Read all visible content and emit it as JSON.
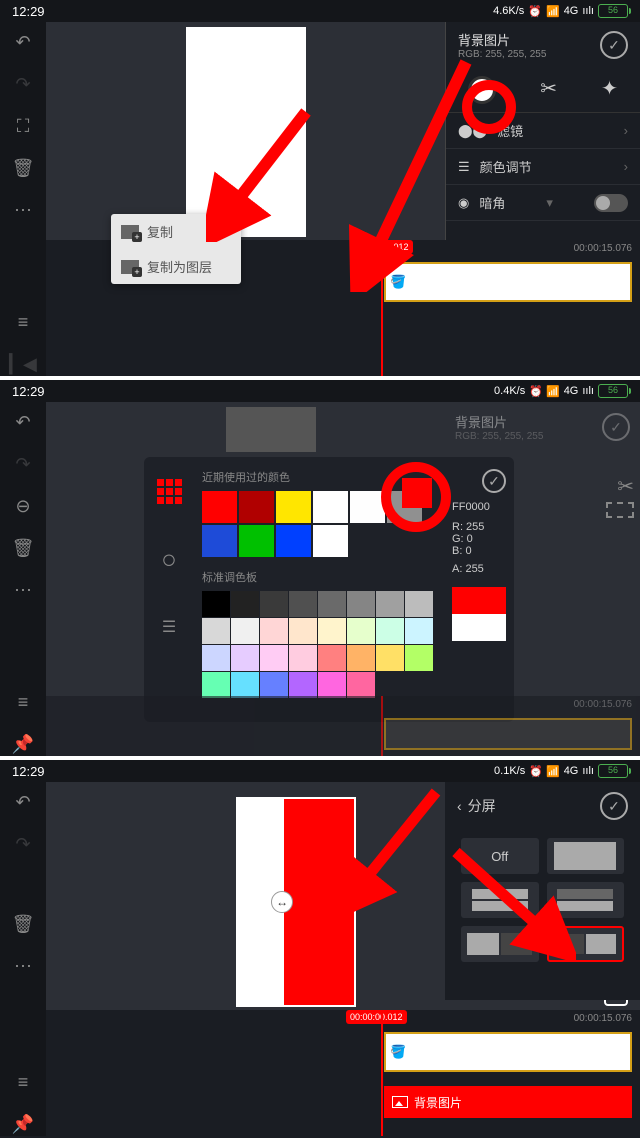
{
  "status": {
    "time": "12:29",
    "speed1": "4.6K/s",
    "speed2": "0.4K/s",
    "speed3": "0.1K/s",
    "net": "4G",
    "battery": "56"
  },
  "panel": {
    "title": "背景图片",
    "rgb": "RGB: 255, 255, 255",
    "filter": "滤镜",
    "coloradj": "颜色调节",
    "vignette": "暗角"
  },
  "popup": {
    "copy": "复制",
    "copyAsLayer": "复制为图层"
  },
  "timeline": {
    "start": "00:00:00.012",
    "end": "00:00:15.076"
  },
  "colorpicker": {
    "recent": "近期使用过的颜色",
    "standard": "标准调色板",
    "hex": "FF0000",
    "r": "R: 255",
    "g": "G: 0",
    "b": "B: 0",
    "a": "A: 255",
    "recentColors": [
      "#ff0000",
      "#b00000",
      "#ffe600",
      "#ffffff",
      "#fefefe",
      "#909090",
      "#1e4bd8",
      "#00c000",
      "#0040ff",
      "#ffffff"
    ],
    "stdColors": [
      "#000000",
      "#222222",
      "#3a3a3a",
      "#505050",
      "#6a6a6a",
      "#858585",
      "#a0a0a0",
      "#bcbcbc",
      "#d8d8d8",
      "#f0f0f0",
      "#ffd6d6",
      "#ffe6cc",
      "#fff4cc",
      "#e6ffcc",
      "#ccffe6",
      "#ccf4ff",
      "#ccd6ff",
      "#e6ccff",
      "#ffccf4",
      "#ffcce0",
      "#ff8080",
      "#ffb366",
      "#ffe066",
      "#b3ff66",
      "#66ffb3",
      "#66e0ff",
      "#6680ff",
      "#b366ff",
      "#ff66e0",
      "#ff66a0"
    ]
  },
  "split": {
    "title": "分屏",
    "off": "Off"
  },
  "layer": "背景图片"
}
